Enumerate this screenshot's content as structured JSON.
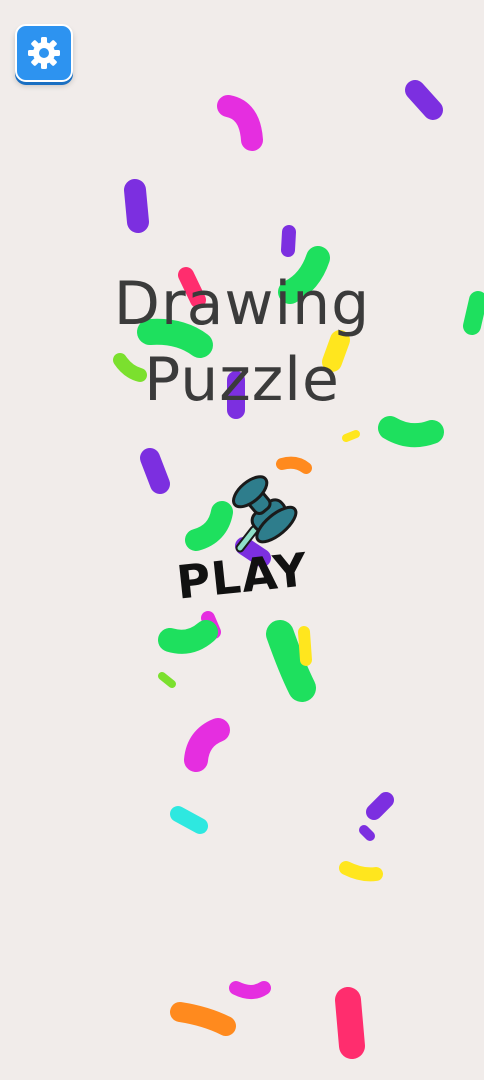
{
  "title": {
    "line1": "Drawing",
    "line2": "Puzzle"
  },
  "play": {
    "label": "PLAY"
  },
  "icons": {
    "settings": "gear-icon",
    "pin": "push-pin-icon"
  },
  "colors": {
    "background": "#f1ecea",
    "settings_button": "#2d93f0",
    "title_text": "#3b3b3b",
    "pin": "#2e7d8c",
    "confetti": [
      "#e52ee0",
      "#7c2fe0",
      "#1ee05e",
      "#ff2d6e",
      "#ffe61e",
      "#2ee8e0",
      "#ff8a1e",
      "#7be02e"
    ]
  }
}
